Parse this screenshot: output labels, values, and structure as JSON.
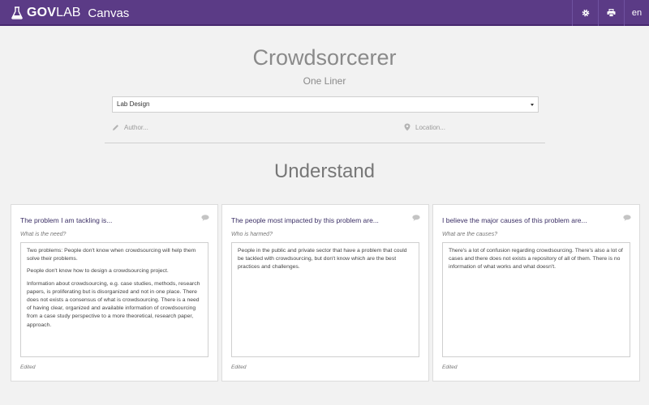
{
  "topbar": {
    "brand_bold": "GOV",
    "brand_light": "LAB",
    "app_name": "Canvas",
    "language": "en",
    "icons": [
      "flask-icon",
      "gear-icon",
      "print-icon"
    ],
    "colors": {
      "bar": "#5b3b86",
      "text": "#ffffff"
    }
  },
  "header": {
    "title": "Crowdsorcerer",
    "subtitle": "One Liner"
  },
  "project_select": {
    "selected": "Lab Design"
  },
  "author": {
    "placeholder": "Author..."
  },
  "location": {
    "placeholder": "Location..."
  },
  "section": {
    "title": "Understand"
  },
  "cards": [
    {
      "title": "The problem I am tackling is...",
      "hint": "What is the need?",
      "paragraphs": [
        "Two problems: People don't know when crowdsourcing will help them solve their problems.",
        "People don't know how to design a crowdsourcing project.",
        "Information about crowdsourcing, e.g. case studies, methods, research papers, is proliferating but is disorganized and not in one place. There does not exists a consensus of what is crowdsourcing. There is a need of having clear, organized and available information of crowdsourcing from a case study perspective to a more theoretical, research paper, approach."
      ],
      "status": "Edited"
    },
    {
      "title": "The people most impacted by this problem are...",
      "hint": "Who is harmed?",
      "paragraphs": [
        "People in the public and private sector that have a problem that could be tackled with crowdsourcing, but don't know which are the best practices and challenges."
      ],
      "status": "Edited"
    },
    {
      "title": "I believe the major causes of this problem are...",
      "hint": "What are the causes?",
      "paragraphs": [
        "There's a lot of confusion regarding crowdsourcing. There's also a lot of cases and there does not exists a repository of all of them. There is no information of what works and what doesn't."
      ],
      "status": "Edited"
    }
  ]
}
